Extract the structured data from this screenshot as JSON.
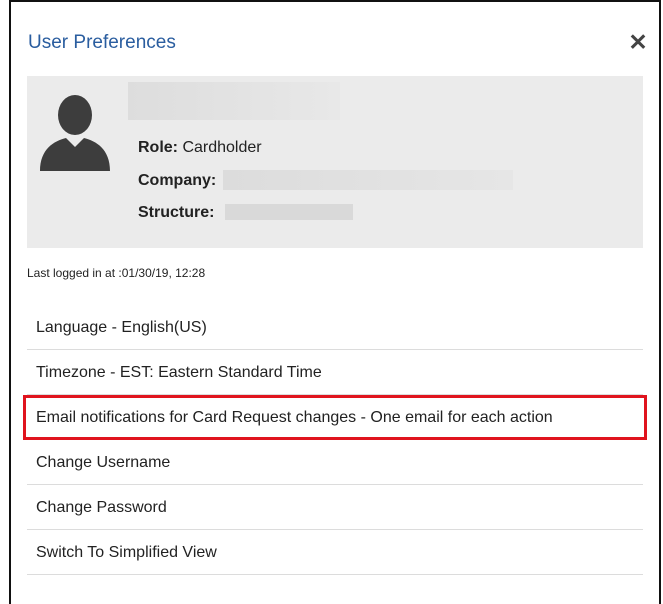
{
  "dialog": {
    "title": "User Preferences",
    "close_icon": "close-icon"
  },
  "profile": {
    "avatar_icon": "user-silhouette-icon",
    "role_label": "Role:",
    "role_value": "Cardholder",
    "company_label": "Company:",
    "structure_label": "Structure:"
  },
  "last_login": "Last logged in at :01/30/19, 12:28",
  "menu": {
    "items": [
      {
        "label": "Language - English(US)"
      },
      {
        "label": "Timezone - EST: Eastern Standard Time"
      },
      {
        "label": "Email notifications for Card Request changes - One email for each action"
      },
      {
        "label": "Change Username"
      },
      {
        "label": "Change Password"
      },
      {
        "label": "Switch To Simplified View"
      }
    ]
  },
  "colors": {
    "title": "#2a5d9f",
    "highlight": "#e0141e",
    "card_background": "#ebebeb"
  }
}
